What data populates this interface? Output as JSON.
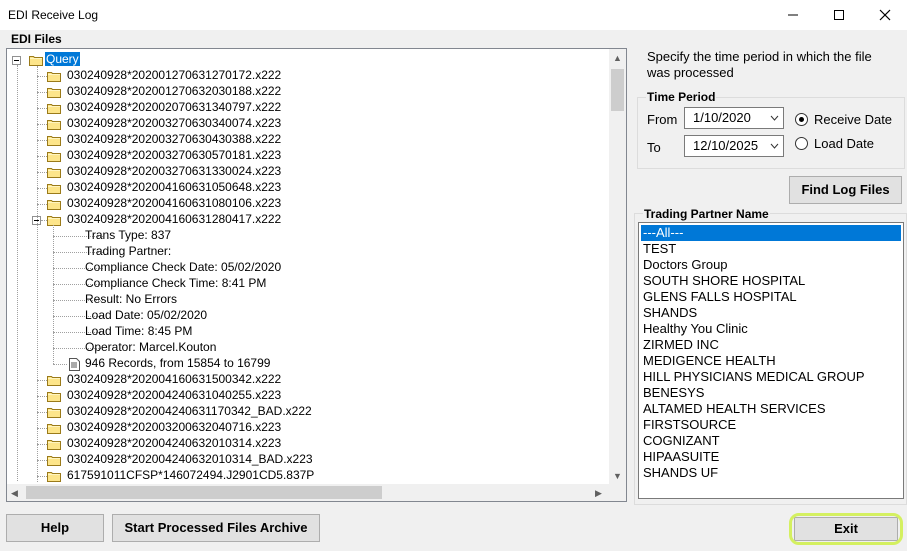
{
  "window": {
    "title": "EDI Receive Log"
  },
  "edi_files": {
    "label": "EDI Files",
    "root": "Query",
    "items_before": [
      "030240928*202001270631270172.x222",
      "030240928*202001270632030188.x222",
      "030240928*202002070631340797.x222",
      "030240928*202003270630340074.x223",
      "030240928*202003270630430388.x222",
      "030240928*202003270630570181.x223",
      "030240928*202003270631330024.x223",
      "030240928*202004160631050648.x223",
      "030240928*202004160631080106.x223"
    ],
    "expanded_item": "030240928*202004160631280417.x222",
    "details": [
      "Trans Type: 837",
      "Trading Partner:",
      "Compliance Check Date: 05/02/2020",
      "Compliance Check Time: 8:41 PM",
      "Result: No Errors",
      "Load Date: 05/02/2020",
      "Load Time: 8:45 PM",
      "Operator: Marcel.Kouton"
    ],
    "records": "946 Records, from 15854 to 16799",
    "items_after": [
      "030240928*202004160631500342.x222",
      "030240928*202004240631040255.x223",
      "030240928*202004240631170342_BAD.x222",
      "030240928*202003200632040716.x223",
      "030240928*202004240632010314.x223",
      "030240928*202004240632010314_BAD.x223",
      "617591011CFSP*146072494.J2901CD5.837P"
    ]
  },
  "instruction": "Specify the time period in which the file was processed",
  "time_period": {
    "label": "Time Period",
    "from_label": "From",
    "from_value": "1/10/2020",
    "to_label": "To",
    "to_value": "12/10/2025",
    "receive_date_label": "Receive Date",
    "load_date_label": "Load Date",
    "selected": "Receive Date"
  },
  "find_button": "Find Log Files",
  "trading_partner": {
    "label": "Trading Partner Name",
    "selected": "---All---",
    "items": [
      "---All---",
      "TEST",
      "Doctors Group",
      "SOUTH SHORE HOSPITAL",
      "GLENS FALLS HOSPITAL",
      "SHANDS",
      "Healthy You Clinic",
      "ZIRMED INC",
      "MEDIGENCE HEALTH",
      "HILL PHYSICIANS MEDICAL GROUP",
      "BENESYS",
      "ALTAMED HEALTH SERVICES",
      "FIRSTSOURCE",
      "COGNIZANT",
      "HIPAASUITE",
      "SHANDS UF"
    ]
  },
  "buttons": {
    "help": "Help",
    "archive": "Start Processed Files Archive",
    "exit": "Exit"
  },
  "colors": {
    "selection": "#0078d7",
    "highlight_ring": "#d4f060"
  }
}
